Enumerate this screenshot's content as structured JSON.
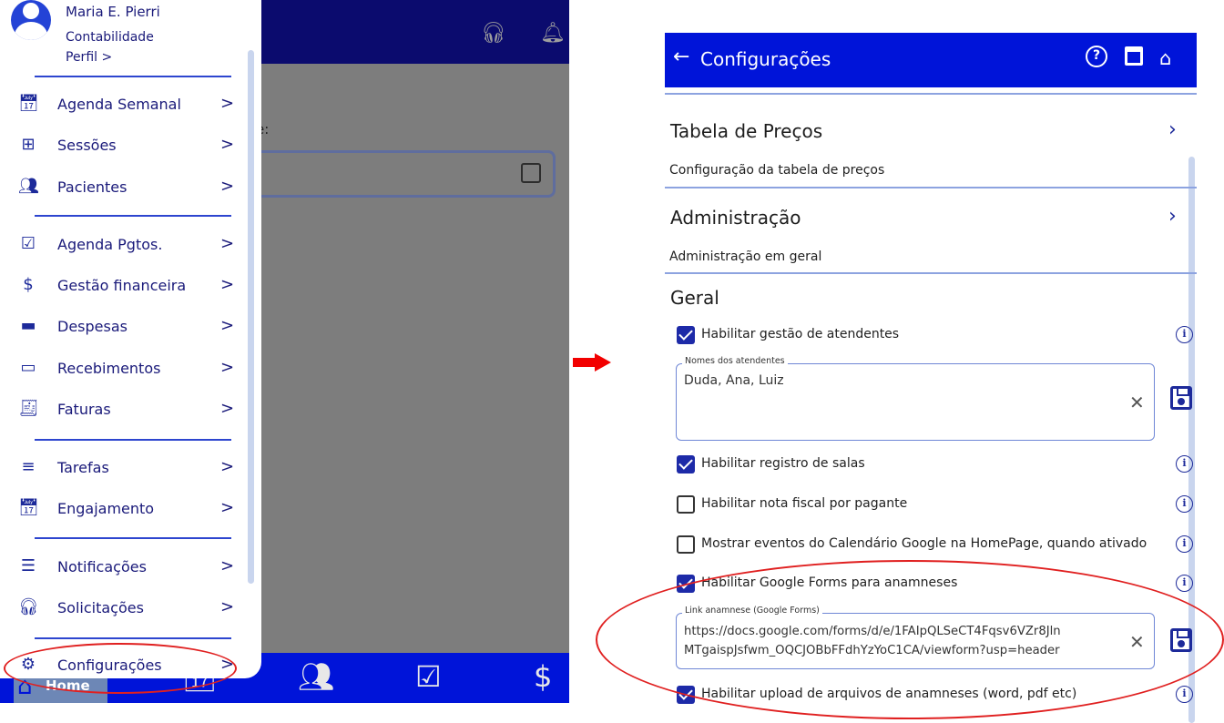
{
  "left": {
    "user": {
      "name": "Maria E. Pierri",
      "department": "Contabilidade",
      "profile_link": "Perfil  >"
    },
    "menu": [
      {
        "label": "Agenda Semanal",
        "icon": "calendar-icon"
      },
      {
        "label": "Sessões",
        "icon": "session-plus-icon"
      },
      {
        "label": "Pacientes",
        "icon": "people-icon"
      },
      {
        "label": "Agenda Pgtos.",
        "icon": "calendar-check-icon"
      },
      {
        "label": "Gestão financeira",
        "icon": "dollar-icon"
      },
      {
        "label": "Despesas",
        "icon": "wallet-icon"
      },
      {
        "label": "Recebimentos",
        "icon": "credit-card-icon"
      },
      {
        "label": "Faturas",
        "icon": "invoice-icon"
      },
      {
        "label": "Tarefas",
        "icon": "list-icon"
      },
      {
        "label": "Engajamento",
        "icon": "calendar-event-icon"
      },
      {
        "label": "Notificações",
        "icon": "notifications-icon"
      },
      {
        "label": "Solicitações",
        "icon": "headset-icon"
      },
      {
        "label": "Configurações",
        "icon": "gear-icon"
      }
    ],
    "chevron": ">",
    "body_label_fragment": "e:",
    "bottom_nav": {
      "home_label": "Home"
    }
  },
  "right": {
    "title": "Configurações",
    "sections": [
      {
        "title": "Tabela de Preços",
        "description": "Configuração da tabela de preços"
      },
      {
        "title": "Administração",
        "description": "Administração em geral"
      }
    ],
    "general": {
      "title": "Geral",
      "options": [
        {
          "label": "Habilitar gestão de atendentes",
          "checked": true
        },
        {
          "label": "Habilitar registro de salas",
          "checked": true
        },
        {
          "label": "Habilitar nota fiscal por pagante",
          "checked": false
        },
        {
          "label": "Mostrar eventos do Calendário Google na HomePage, quando ativado",
          "checked": false
        },
        {
          "label": "Habilitar Google Forms para anamneses",
          "checked": true
        },
        {
          "label": "Habilitar upload de arquivos de anamneses (word, pdf etc)",
          "checked": true
        }
      ],
      "attendants_field": {
        "label": "Nomes dos atendentes",
        "value": "Duda, Ana, Luiz"
      },
      "forms_field": {
        "label": "Link anamnese (Google Forms)",
        "value": "https://docs.google.com/forms/d/e/1FAIpQLSeCT4Fqsv6VZr8JlnMTgaispJsfwm_OQCJOBbFFdhYzYoC1CA/viewform?usp=header",
        "line1": "https://docs.google.com/forms/d/e/1FAIpQLSeCT4Fqsv6VZr8Jln",
        "line2": "MTgaispJsfwm_OQCJOBbFFdhYzYoC1CA/viewform?usp=header"
      }
    }
  },
  "colors": {
    "primary": "#0014d9",
    "dark_header": "#0b0b6e",
    "accent": "#1d2aa8",
    "annotation": "#e02020"
  }
}
